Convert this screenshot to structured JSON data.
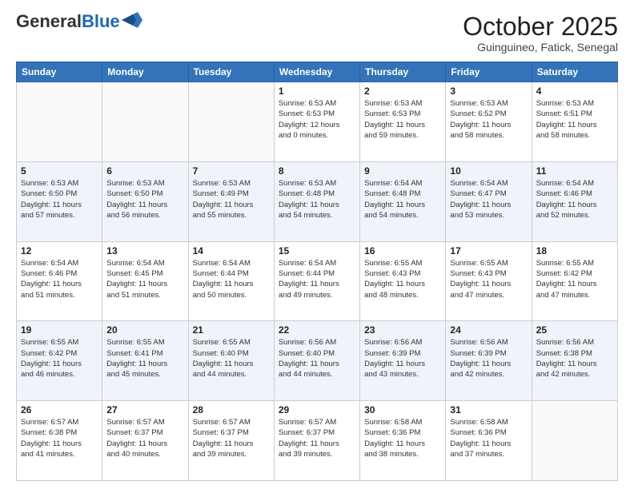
{
  "header": {
    "logo_general": "General",
    "logo_blue": "Blue",
    "month_title": "October 2025",
    "location": "Guinguineo, Fatick, Senegal"
  },
  "days_of_week": [
    "Sunday",
    "Monday",
    "Tuesday",
    "Wednesday",
    "Thursday",
    "Friday",
    "Saturday"
  ],
  "weeks": [
    {
      "shade": false,
      "days": [
        {
          "num": "",
          "info": ""
        },
        {
          "num": "",
          "info": ""
        },
        {
          "num": "",
          "info": ""
        },
        {
          "num": "1",
          "info": "Sunrise: 6:53 AM\nSunset: 6:53 PM\nDaylight: 12 hours\nand 0 minutes."
        },
        {
          "num": "2",
          "info": "Sunrise: 6:53 AM\nSunset: 6:53 PM\nDaylight: 11 hours\nand 59 minutes."
        },
        {
          "num": "3",
          "info": "Sunrise: 6:53 AM\nSunset: 6:52 PM\nDaylight: 11 hours\nand 58 minutes."
        },
        {
          "num": "4",
          "info": "Sunrise: 6:53 AM\nSunset: 6:51 PM\nDaylight: 11 hours\nand 58 minutes."
        }
      ]
    },
    {
      "shade": true,
      "days": [
        {
          "num": "5",
          "info": "Sunrise: 6:53 AM\nSunset: 6:50 PM\nDaylight: 11 hours\nand 57 minutes."
        },
        {
          "num": "6",
          "info": "Sunrise: 6:53 AM\nSunset: 6:50 PM\nDaylight: 11 hours\nand 56 minutes."
        },
        {
          "num": "7",
          "info": "Sunrise: 6:53 AM\nSunset: 6:49 PM\nDaylight: 11 hours\nand 55 minutes."
        },
        {
          "num": "8",
          "info": "Sunrise: 6:53 AM\nSunset: 6:48 PM\nDaylight: 11 hours\nand 54 minutes."
        },
        {
          "num": "9",
          "info": "Sunrise: 6:54 AM\nSunset: 6:48 PM\nDaylight: 11 hours\nand 54 minutes."
        },
        {
          "num": "10",
          "info": "Sunrise: 6:54 AM\nSunset: 6:47 PM\nDaylight: 11 hours\nand 53 minutes."
        },
        {
          "num": "11",
          "info": "Sunrise: 6:54 AM\nSunset: 6:46 PM\nDaylight: 11 hours\nand 52 minutes."
        }
      ]
    },
    {
      "shade": false,
      "days": [
        {
          "num": "12",
          "info": "Sunrise: 6:54 AM\nSunset: 6:46 PM\nDaylight: 11 hours\nand 51 minutes."
        },
        {
          "num": "13",
          "info": "Sunrise: 6:54 AM\nSunset: 6:45 PM\nDaylight: 11 hours\nand 51 minutes."
        },
        {
          "num": "14",
          "info": "Sunrise: 6:54 AM\nSunset: 6:44 PM\nDaylight: 11 hours\nand 50 minutes."
        },
        {
          "num": "15",
          "info": "Sunrise: 6:54 AM\nSunset: 6:44 PM\nDaylight: 11 hours\nand 49 minutes."
        },
        {
          "num": "16",
          "info": "Sunrise: 6:55 AM\nSunset: 6:43 PM\nDaylight: 11 hours\nand 48 minutes."
        },
        {
          "num": "17",
          "info": "Sunrise: 6:55 AM\nSunset: 6:43 PM\nDaylight: 11 hours\nand 47 minutes."
        },
        {
          "num": "18",
          "info": "Sunrise: 6:55 AM\nSunset: 6:42 PM\nDaylight: 11 hours\nand 47 minutes."
        }
      ]
    },
    {
      "shade": true,
      "days": [
        {
          "num": "19",
          "info": "Sunrise: 6:55 AM\nSunset: 6:42 PM\nDaylight: 11 hours\nand 46 minutes."
        },
        {
          "num": "20",
          "info": "Sunrise: 6:55 AM\nSunset: 6:41 PM\nDaylight: 11 hours\nand 45 minutes."
        },
        {
          "num": "21",
          "info": "Sunrise: 6:55 AM\nSunset: 6:40 PM\nDaylight: 11 hours\nand 44 minutes."
        },
        {
          "num": "22",
          "info": "Sunrise: 6:56 AM\nSunset: 6:40 PM\nDaylight: 11 hours\nand 44 minutes."
        },
        {
          "num": "23",
          "info": "Sunrise: 6:56 AM\nSunset: 6:39 PM\nDaylight: 11 hours\nand 43 minutes."
        },
        {
          "num": "24",
          "info": "Sunrise: 6:56 AM\nSunset: 6:39 PM\nDaylight: 11 hours\nand 42 minutes."
        },
        {
          "num": "25",
          "info": "Sunrise: 6:56 AM\nSunset: 6:38 PM\nDaylight: 11 hours\nand 42 minutes."
        }
      ]
    },
    {
      "shade": false,
      "days": [
        {
          "num": "26",
          "info": "Sunrise: 6:57 AM\nSunset: 6:38 PM\nDaylight: 11 hours\nand 41 minutes."
        },
        {
          "num": "27",
          "info": "Sunrise: 6:57 AM\nSunset: 6:37 PM\nDaylight: 11 hours\nand 40 minutes."
        },
        {
          "num": "28",
          "info": "Sunrise: 6:57 AM\nSunset: 6:37 PM\nDaylight: 11 hours\nand 39 minutes."
        },
        {
          "num": "29",
          "info": "Sunrise: 6:57 AM\nSunset: 6:37 PM\nDaylight: 11 hours\nand 39 minutes."
        },
        {
          "num": "30",
          "info": "Sunrise: 6:58 AM\nSunset: 6:36 PM\nDaylight: 11 hours\nand 38 minutes."
        },
        {
          "num": "31",
          "info": "Sunrise: 6:58 AM\nSunset: 6:36 PM\nDaylight: 11 hours\nand 37 minutes."
        },
        {
          "num": "",
          "info": ""
        }
      ]
    }
  ]
}
